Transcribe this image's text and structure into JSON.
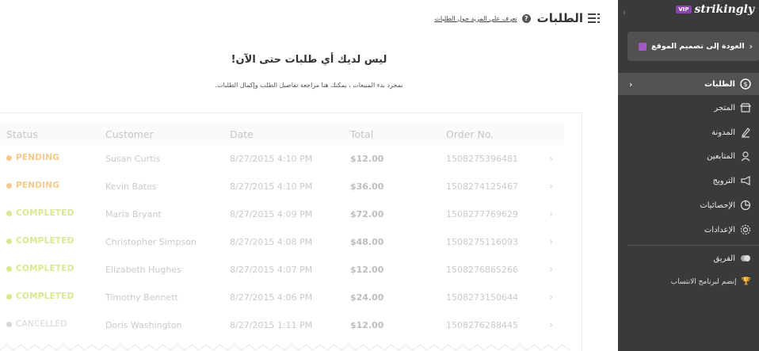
{
  "header": {
    "title": "الطلبات",
    "learn_more": "تعرف على المزيد حول الطلبات"
  },
  "empty_state": {
    "title": "ليس لديك أي طلبات حتى الآن!",
    "subtitle": "بمجرد بدء المبيعات ، يمكنك هنا مراجعة تفاصيل الطلب وإكمال الطلبات."
  },
  "table": {
    "columns": [
      "Status",
      "Customer",
      "Date",
      "Total",
      "Order No."
    ],
    "rows": [
      {
        "status": "PENDING",
        "customer": "Susan Curtis",
        "date": "8/27/2015 4:10 PM",
        "total": "$12.00",
        "order": "1508275396481"
      },
      {
        "status": "PENDING",
        "customer": "Kevin Bates",
        "date": "8/27/2015 4:10 PM",
        "total": "$36.00",
        "order": "1508274125467"
      },
      {
        "status": "COMPLETED",
        "customer": "Maria Bryant",
        "date": "8/27/2015 4:09 PM",
        "total": "$72.00",
        "order": "1508277769629"
      },
      {
        "status": "COMPLETED",
        "customer": "Christopher Simpson",
        "date": "8/27/2015 4:08 PM",
        "total": "$48.00",
        "order": "1508275116093"
      },
      {
        "status": "COMPLETED",
        "customer": "Elizabeth Hughes",
        "date": "8/27/2015 4:07 PM",
        "total": "$12.00",
        "order": "1508276865266"
      },
      {
        "status": "COMPLETED",
        "customer": "Timothy Bennett",
        "date": "8/27/2015 4:06 PM",
        "total": "$24.00",
        "order": "1508273150644"
      },
      {
        "status": "CANCELLED",
        "customer": "Doris Washington",
        "date": "8/27/2015 1:11 PM",
        "total": "$12.00",
        "order": "1508276288445"
      }
    ]
  },
  "status_colors": {
    "PENDING": "#f7c98a",
    "COMPLETED": "#d9e98f",
    "CANCELLED": "#d6d6d6"
  },
  "sidebar": {
    "brand_badge": "VIP",
    "brand_name": "strikingly",
    "back_label": "العودة إلى تصميم الموقع",
    "items": [
      {
        "label": "الطلبات",
        "icon": "dollar-circle-icon",
        "active": true
      },
      {
        "label": "المتجر",
        "icon": "store-icon",
        "active": false
      },
      {
        "label": "المدونة",
        "icon": "pen-icon",
        "active": false
      },
      {
        "label": "المتابعين",
        "icon": "followers-icon",
        "active": false
      },
      {
        "label": "الترويج",
        "icon": "megaphone-icon",
        "active": false
      },
      {
        "label": "الإحصائيات",
        "icon": "pie-chart-icon",
        "active": false
      },
      {
        "label": "الإعدادات",
        "icon": "gear-icon",
        "active": false
      },
      {
        "label": "الفريق",
        "icon": "team-icon",
        "active": false
      }
    ],
    "join_label": "إنضم لبرنامج الانتساب"
  }
}
